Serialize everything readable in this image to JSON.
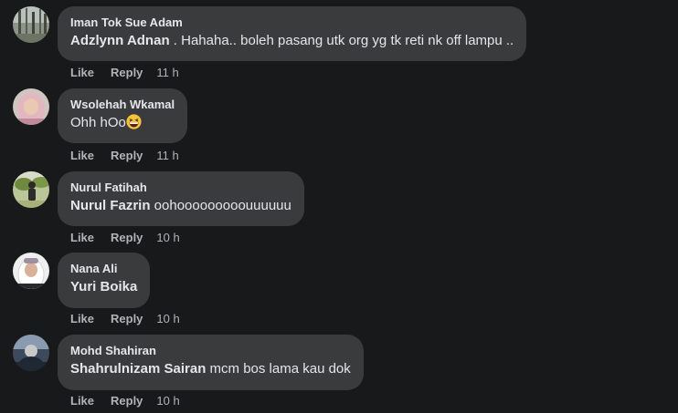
{
  "comments": [
    {
      "author": "Iman Tok Sue Adam",
      "mention": "Adzlynn Adnan",
      "text": " . Hahaha.. boleh pasang utk org yg tk reti nk off lampu ..",
      "like": "Like",
      "reply": "Reply",
      "time": "11 h",
      "avatar": "avatar-trees-photo"
    },
    {
      "author": "Wsolehah Wkamal",
      "mention": "",
      "text": "Ohh hOo",
      "emoji": "grinning-squinting-face-emoji",
      "like": "Like",
      "reply": "Reply",
      "time": "11 h",
      "avatar": "avatar-woman-hijab-pink"
    },
    {
      "author": "Nurul Fatihah",
      "mention": "Nurul Fazrin",
      "text": " oohooooooooouuuuuu",
      "like": "Like",
      "reply": "Reply",
      "time": "10 h",
      "avatar": "avatar-person-outdoors"
    },
    {
      "author": "Nana Ali",
      "mention": "Yuri Boika",
      "text": "",
      "like": "Like",
      "reply": "Reply",
      "time": "10 h",
      "avatar": "avatar-woman-hijab-white"
    },
    {
      "author": "Mohd Shahiran",
      "mention": "Shahrulnizam Sairan",
      "text": " mcm bos lama kau dok",
      "like": "Like",
      "reply": "Reply",
      "time": "10 h",
      "avatar": "avatar-person-dark"
    }
  ],
  "colors": {
    "background": "#18191a",
    "bubble": "#3a3b3c",
    "primary_text": "#e4e6eb",
    "secondary_text": "#b0b3b8"
  }
}
